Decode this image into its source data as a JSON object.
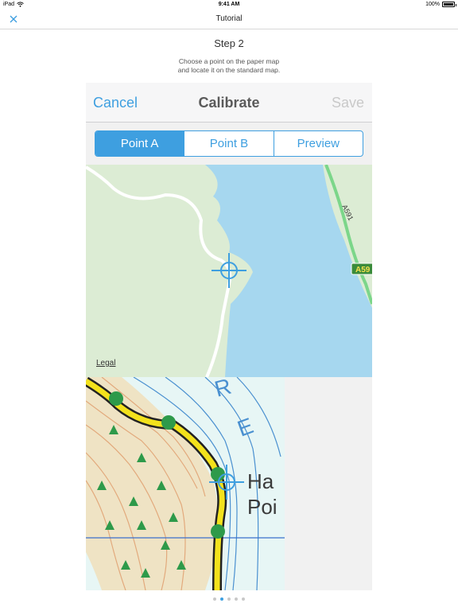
{
  "status_bar": {
    "carrier": "iPad",
    "time": "9:41 AM",
    "battery": "100%"
  },
  "nav": {
    "title": "Tutorial",
    "close_icon": "close-x-icon"
  },
  "step": {
    "title": "Step 2",
    "description_line1": "Choose a point on the paper map",
    "description_line2": "and locate it on the standard map."
  },
  "calibrate": {
    "cancel_label": "Cancel",
    "title": "Calibrate",
    "save_label": "Save",
    "segments": [
      {
        "label": "Point A",
        "selected": true
      },
      {
        "label": "Point B",
        "selected": false
      },
      {
        "label": "Preview",
        "selected": false
      }
    ]
  },
  "standard_map": {
    "road_label": "A591",
    "road_shield": "A59",
    "legal_label": "Legal"
  },
  "paper_map": {
    "place_label_line1": "Ha",
    "place_label_line2": "Poi",
    "water_letter_1": "R",
    "water_letter_2": "E"
  },
  "page_indicator": {
    "count": 5,
    "current": 2
  },
  "colors": {
    "accent": "#3e9fe0",
    "water": "#a6d7ef",
    "land": "#dcecd4",
    "road_green": "#7cd68a"
  }
}
